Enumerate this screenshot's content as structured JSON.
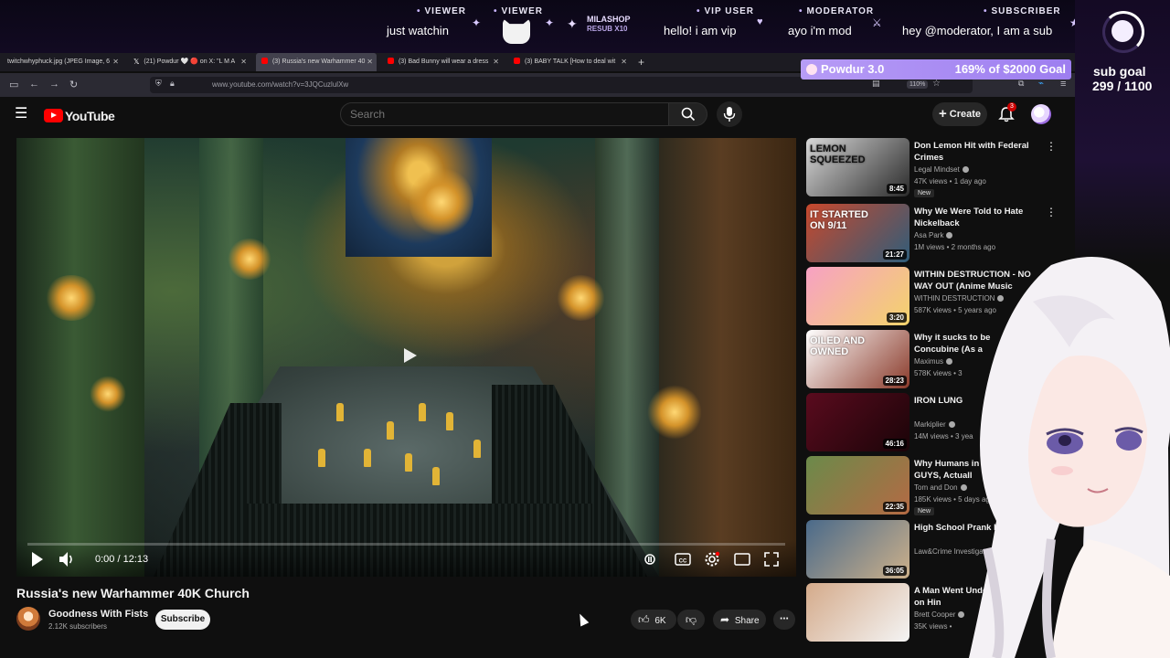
{
  "overlay": {
    "chat": [
      {
        "role": "VIEWER",
        "text": "just watchin"
      },
      {
        "role": "VIEWER",
        "text": ""
      },
      {
        "role": "MILASHOP",
        "text": "RESUB X10"
      },
      {
        "role": "VIP USER",
        "text": "hello! i am vip"
      },
      {
        "role": "MODERATOR",
        "text": "ayo i'm mod"
      },
      {
        "role": "SUBSCRIBER",
        "text": "hey @moderator, I am a sub"
      }
    ],
    "goal": {
      "name": "Powdur 3.0",
      "progress_text": "169% of $2000 Goal",
      "percent": 169
    },
    "sub_goal": {
      "label": "sub goal",
      "count": "299 / 1100",
      "current": 299,
      "target": 1100
    }
  },
  "browser": {
    "tabs": [
      {
        "title": "twitchwhyphuck.jpg (JPEG Image, 6",
        "active": false,
        "icon_color": "#888888"
      },
      {
        "title": "(21) Powdur 🤍 🔴 on X: \"L M A",
        "active": false,
        "icon_color": "#ffffff"
      },
      {
        "title": "(3) Russia's new Warhammer 40",
        "active": true,
        "icon_color": "#ff0000"
      },
      {
        "title": "(3) Bad Bunny will wear a dress",
        "active": false,
        "icon_color": "#ff0000"
      },
      {
        "title": "(3) BABY TALK [How to deal wit",
        "active": false,
        "icon_color": "#ff0000"
      }
    ],
    "url": "www.youtube.com/watch?v=3JQCuzlulXw",
    "zoom": "110%"
  },
  "youtube": {
    "logo_text": "YouTube",
    "search_placeholder": "Search",
    "create_label": "Create",
    "notif_count": "3",
    "video": {
      "title": "Russia's new Warhammer 40K Church",
      "time": "0:00 / 12:13",
      "progress": 0
    },
    "channel": {
      "name": "Goodness With Fists",
      "subs": "2.12K subscribers"
    },
    "subscribe_label": "Subscribe",
    "likes": "6K",
    "share_label": "Share",
    "recommendations": [
      {
        "title": "Don Lemon Hit with Federal Crimes",
        "channel": "Legal Mindset",
        "meta": "47K views • 1 day ago",
        "duration": "8:45",
        "badge": "New",
        "thumb_text": "LEMON SQUEEZED",
        "c1": "#d8d8d8",
        "c2": "#2a2a2a"
      },
      {
        "title": "Why We Were Told to Hate Nickelback",
        "channel": "Asa Park",
        "meta": "1M views • 2 months ago",
        "duration": "21:27",
        "badge": "",
        "thumb_text": "IT STARTED ON 9/11",
        "c1": "#c8482c",
        "c2": "#2f5d7a"
      },
      {
        "title": "WITHIN DESTRUCTION - NO WAY OUT (Anime Music Vide",
        "channel": "WITHIN DESTRUCTION",
        "meta": "587K views • 5 years ago",
        "duration": "3:20",
        "badge": "",
        "thumb_text": "",
        "c1": "#f7a1c4",
        "c2": "#f3d36b"
      },
      {
        "title": "Why it sucks to be Concubine (As a",
        "channel": "Maximus",
        "meta": "578K views • 3",
        "duration": "28:23",
        "badge": "",
        "thumb_text": "OILED AND OWNED",
        "c1": "#ffffff",
        "c2": "#8a3a2a"
      },
      {
        "title": "IRON LUNG",
        "channel": "Markiplier",
        "meta": "14M views • 3 yea",
        "duration": "46:16",
        "badge": "",
        "thumb_text": "",
        "c1": "#5a0b1e",
        "c2": "#1a0408"
      },
      {
        "title": "Why Humans in 40k GOOD GUYS, Actuall",
        "channel": "Tom and Don",
        "meta": "185K views • 5 days ago",
        "duration": "22:35",
        "badge": "New",
        "thumb_text": "",
        "c1": "#6b8a4a",
        "c2": "#b46a44"
      },
      {
        "title": "High School Prank Kil Four",
        "channel": "Law&Crime Investigat",
        "meta": "",
        "duration": "36:05",
        "badge": "",
        "thumb_text": "",
        "c1": "#4a6a8a",
        "c2": "#ccb08a"
      },
      {
        "title": "A Man Went Under Hot Girl on Hin",
        "channel": "Brett Cooper",
        "meta": "35K views •",
        "duration": "",
        "badge": "",
        "thumb_text": "",
        "c1": "#d4aa8a",
        "c2": "#f4f4f4"
      }
    ]
  },
  "colors": {
    "yt_red": "#ff0000",
    "goal_purple": "#b79cf6",
    "overlay_bg": "#0b0716"
  }
}
